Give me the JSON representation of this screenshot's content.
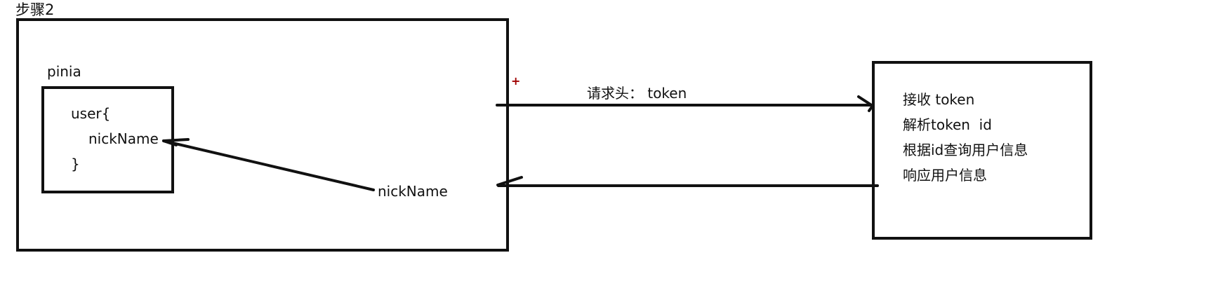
{
  "step_title": "步骤2",
  "client": {
    "pinia_label": "pinia",
    "store_lines": [
      "user{",
      "nickName",
      "}"
    ],
    "returned_value_label": "nickName"
  },
  "request": {
    "header_label": "请求头： token"
  },
  "server": {
    "lines": [
      "接收 token",
      "解析token  id",
      "根据id查询用户信息",
      "响应用户信息"
    ]
  },
  "mark": "+",
  "colors": {
    "stroke": "#111111",
    "mark": "#a00000"
  }
}
